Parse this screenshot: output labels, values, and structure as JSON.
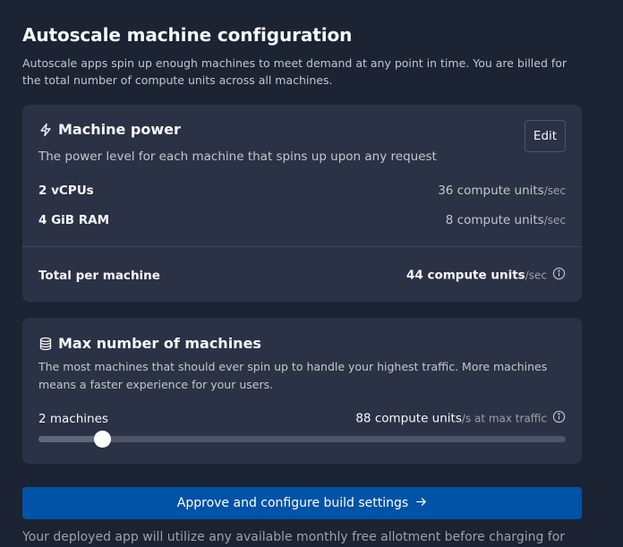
{
  "header": {
    "title": "Autoscale machine configuration",
    "description": "Autoscale apps spin up enough machines to meet demand at any point in time. You are billed for the total number of compute units across all machines."
  },
  "machine_power": {
    "heading": "Machine power",
    "subtitle": "The power level for each machine that spins up upon any request",
    "edit_label": "Edit",
    "rows": [
      {
        "label": "2 vCPUs",
        "value": "36 compute units",
        "unit": "/sec"
      },
      {
        "label": "4 GiB RAM",
        "value": "8 compute units",
        "unit": "/sec"
      }
    ],
    "total": {
      "label": "Total per machine",
      "value": "44 compute units",
      "unit": "/sec"
    }
  },
  "max_machines": {
    "heading": "Max number of machines",
    "description": "The most machines that should ever spin up to handle your highest traffic. More machines means a faster experience for your users.",
    "count_label": "2 machines",
    "compute_value": "88 compute units",
    "compute_suffix": "/s at max traffic",
    "slider_fraction": 0.12
  },
  "actions": {
    "approve_label": "Approve and configure build settings"
  },
  "footnote": "Your deployed app will utilize any available monthly free allotment before charging for",
  "icons": {
    "power": "lightning-bolt-icon",
    "machines": "database-stack-icon",
    "info": "info-circle-icon",
    "arrow": "arrow-right-icon"
  },
  "colors": {
    "background": "#1c2333",
    "card": "#2b3245",
    "primary": "#0053a6"
  }
}
